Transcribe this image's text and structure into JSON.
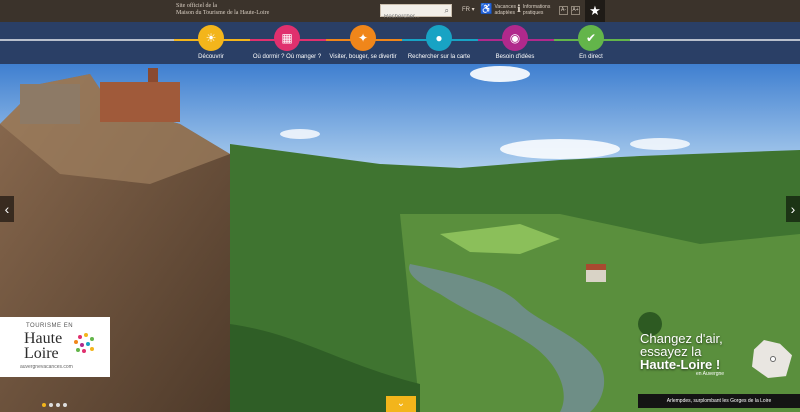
{
  "topbar": {
    "official_line1": "Site officiel de la",
    "official_line2": "Maison du Tourisme de la Haute-Loire",
    "search_placeholder": "Rechercher...",
    "language": "FR",
    "util_vacances_line1": "Vacances",
    "util_vacances_line2": "adaptées",
    "util_infos_line1": "Informations",
    "util_infos_line2": "pratiques",
    "font_minus": "A-",
    "font_plus": "A+"
  },
  "nav": {
    "items": [
      {
        "label": "Découvrir",
        "color": "#f3b51b",
        "icon": "sun-icon",
        "glyph": "☀"
      },
      {
        "label": "Où dormir ? Où manger ?",
        "color": "#e0306e",
        "icon": "bed-icon",
        "glyph": "▦"
      },
      {
        "label": "Visiter, bouger, se divertir",
        "color": "#f0861a",
        "icon": "walker-icon",
        "glyph": "✦"
      },
      {
        "label": "Rechercher sur la carte",
        "color": "#18a3c4",
        "icon": "map-pin-icon",
        "glyph": "●"
      },
      {
        "label": "Besoin d'idées",
        "color": "#b0298c",
        "icon": "lightbulb-icon",
        "glyph": "◉"
      },
      {
        "label": "En direct",
        "color": "#63b54a",
        "icon": "thumbs-up-icon",
        "glyph": "✔"
      }
    ]
  },
  "hero": {
    "logo_tourisme": "TOURISME EN",
    "logo_haute": "Haute",
    "logo_loire": "Loire",
    "logo_url": "auvergnevacances.com",
    "cta_line1": "Changez d'air,",
    "cta_line2": "essayez la",
    "cta_line3": "Haute-Loire !",
    "cta_sub": "en Auvergne",
    "caption": "Arlempdes, surplombant les Gorges de la Loire"
  }
}
